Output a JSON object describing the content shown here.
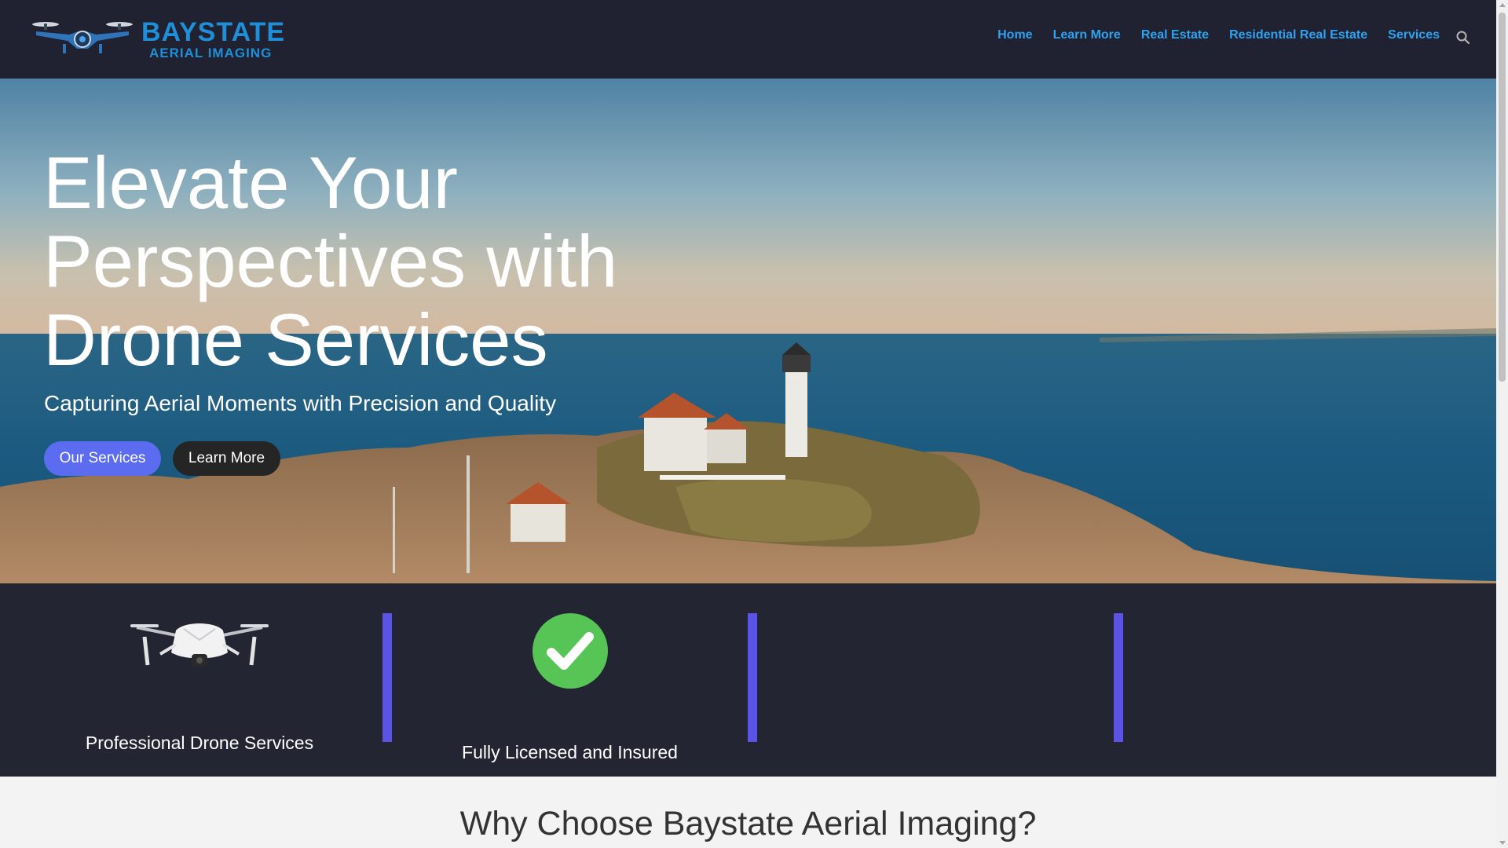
{
  "site": {
    "logo_line1": "BAYSTATE",
    "logo_line2": "AERIAL IMAGING"
  },
  "nav": {
    "items": [
      "Home",
      "Learn More",
      "Real Estate",
      "Residential Real Estate",
      "Services"
    ]
  },
  "hero": {
    "title": "Elevate Your Perspectives with Drone Services",
    "subtitle": "Capturing Aerial Moments with Precision and Quality",
    "primary_button": "Our Services",
    "secondary_button": "Learn More"
  },
  "features": [
    {
      "label": "Professional Drone Services",
      "icon": "drone-icon"
    },
    {
      "label": "Fully Licensed and Insured",
      "icon": "check-circle-icon"
    }
  ],
  "why": {
    "title": "Why Choose Baystate Aerial Imaging?"
  },
  "colors": {
    "header_bg": "#212231",
    "nav_link": "#2ea3f2",
    "primary_button": "#5b6cf0",
    "dark_button": "#252525",
    "features_bg": "#242533",
    "divider": "#5b52e6",
    "check_green": "#57c456"
  }
}
